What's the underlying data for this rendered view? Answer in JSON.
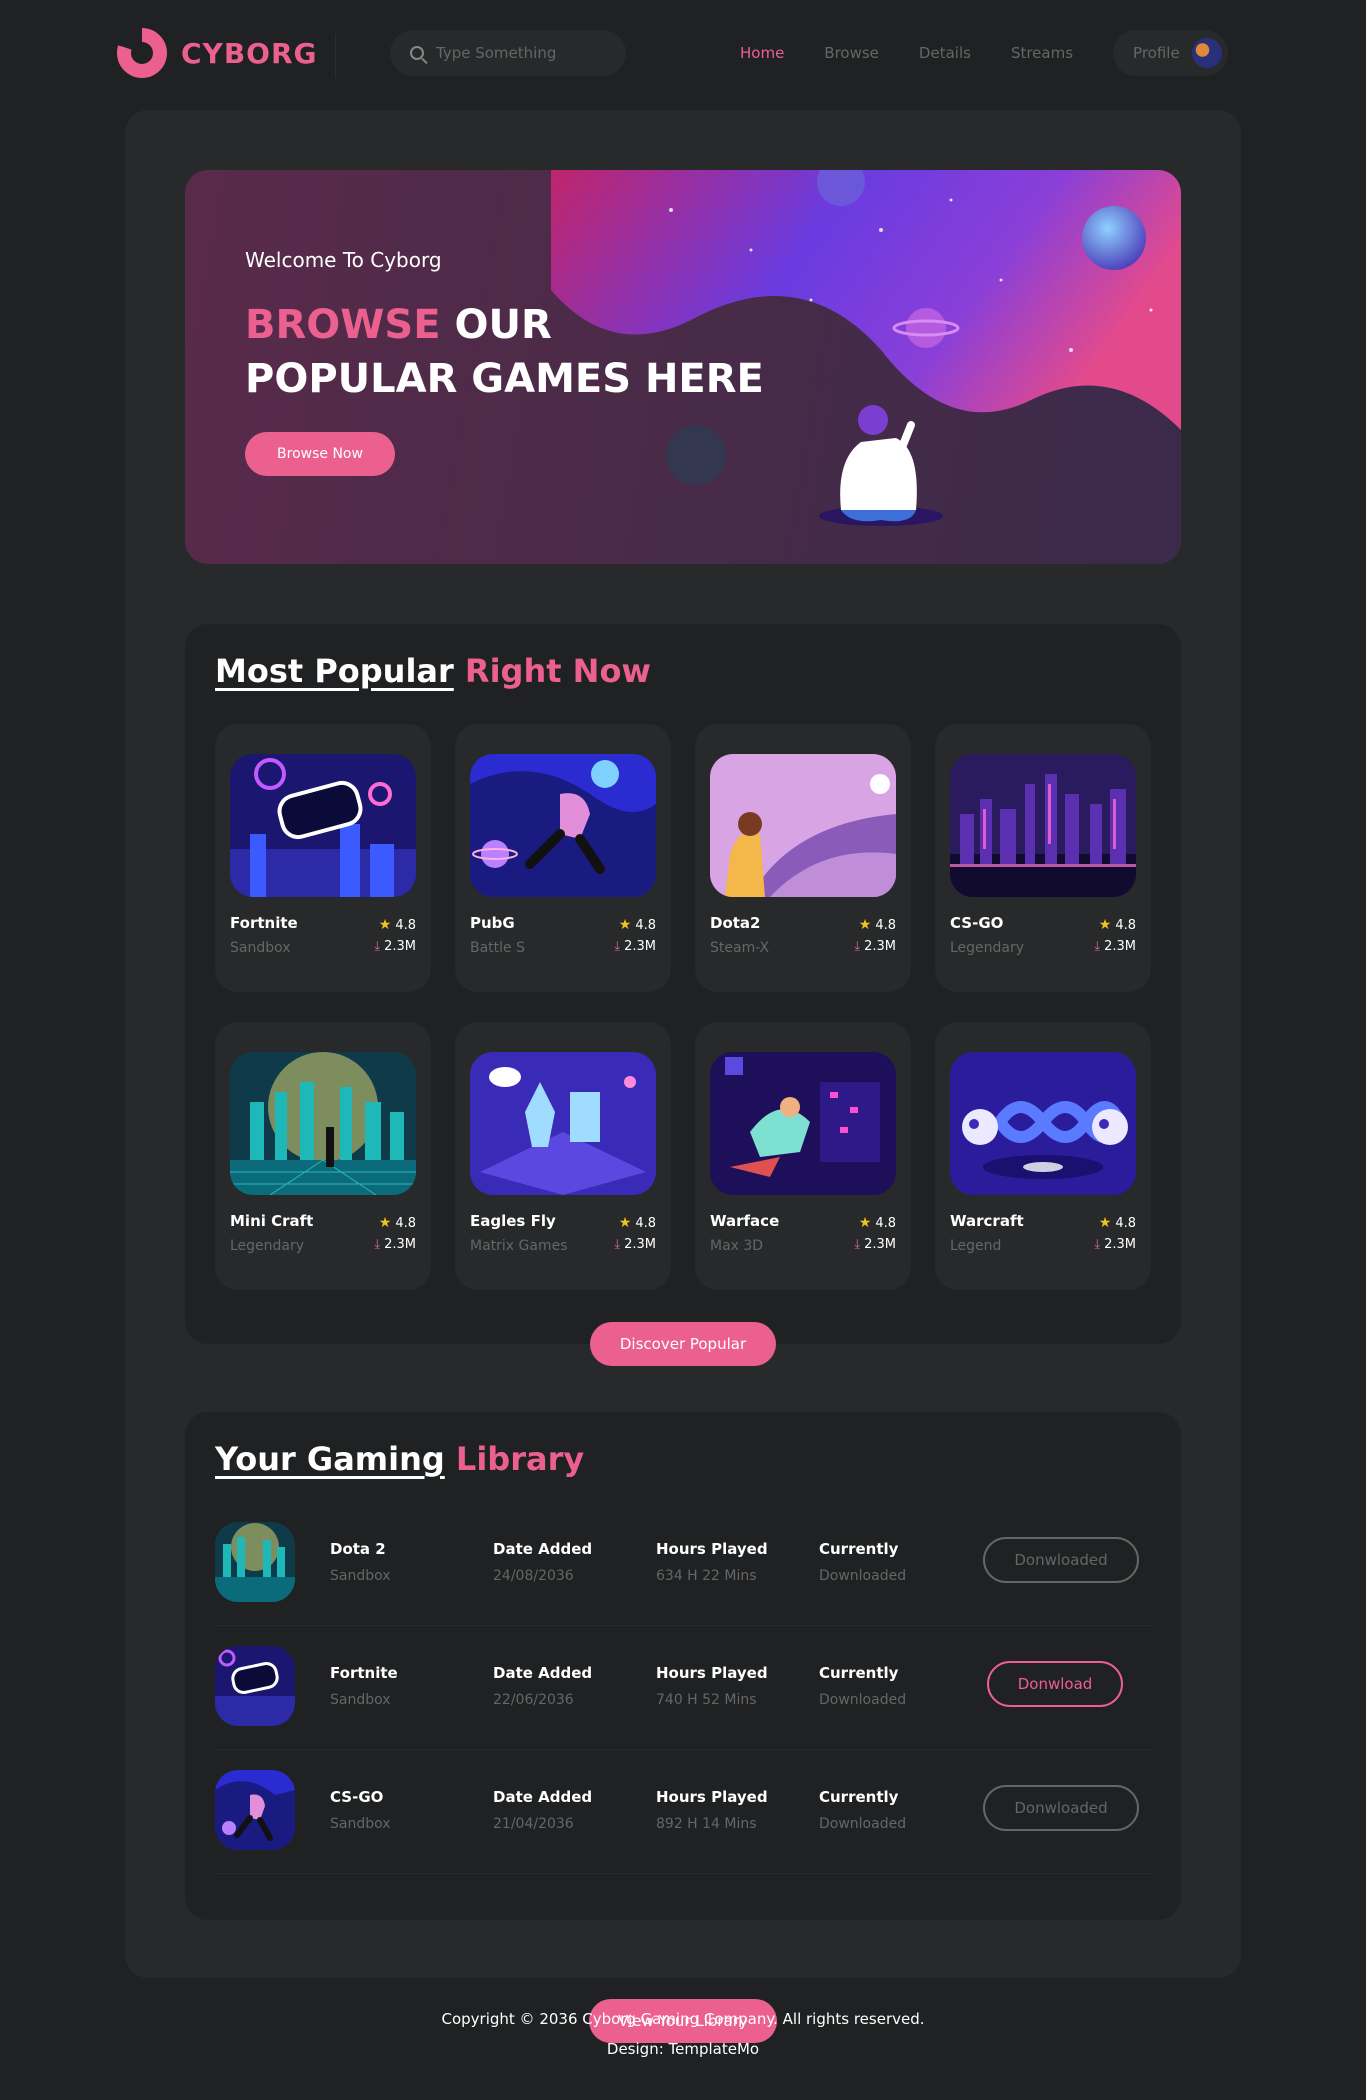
{
  "colors": {
    "accent": "#ec6090",
    "bg": "#1f2122",
    "panel": "#27292a",
    "muted": "#666666",
    "star": "#f0c419"
  },
  "brand": {
    "name": "CYBORG"
  },
  "search": {
    "placeholder": "Type Something"
  },
  "nav": {
    "items": [
      {
        "label": "Home",
        "active": true
      },
      {
        "label": "Browse"
      },
      {
        "label": "Details"
      },
      {
        "label": "Streams"
      }
    ],
    "profile_label": "Profile"
  },
  "banner": {
    "welcome": "Welcome To Cyborg",
    "headline_highlight": "BROWSE",
    "headline_rest1": " OUR",
    "headline_line2": "POPULAR GAMES HERE",
    "button": "Browse Now"
  },
  "popular": {
    "title_underlined": "Most Popular",
    "title_highlight": "Right Now",
    "games": [
      {
        "name": "Fortnite",
        "category": "Sandbox",
        "rating": "4.8",
        "downloads": "2.3M"
      },
      {
        "name": "PubG",
        "category": "Battle S",
        "rating": "4.8",
        "downloads": "2.3M"
      },
      {
        "name": "Dota2",
        "category": "Steam-X",
        "rating": "4.8",
        "downloads": "2.3M"
      },
      {
        "name": "CS-GO",
        "category": "Legendary",
        "rating": "4.8",
        "downloads": "2.3M"
      },
      {
        "name": "Mini Craft",
        "category": "Legendary",
        "rating": "4.8",
        "downloads": "2.3M"
      },
      {
        "name": "Eagles Fly",
        "category": "Matrix Games",
        "rating": "4.8",
        "downloads": "2.3M"
      },
      {
        "name": "Warface",
        "category": "Max 3D",
        "rating": "4.8",
        "downloads": "2.3M"
      },
      {
        "name": "Warcraft",
        "category": "Legend",
        "rating": "4.8",
        "downloads": "2.3M"
      }
    ],
    "button": "Discover Popular"
  },
  "library": {
    "title_underlined": "Your Gaming",
    "title_highlight": "Library",
    "rows": [
      {
        "name": "Dota 2",
        "category": "Sandbox",
        "date_label": "Date Added",
        "date": "24/08/2036",
        "hours_label": "Hours Played",
        "hours": "634 H 22 Mins",
        "status_label": "Currently",
        "status": "Downloaded",
        "button": "Donwloaded",
        "button_active": false
      },
      {
        "name": "Fortnite",
        "category": "Sandbox",
        "date_label": "Date Added",
        "date": "22/06/2036",
        "hours_label": "Hours Played",
        "hours": "740 H 52 Mins",
        "status_label": "Currently",
        "status": "Downloaded",
        "button": "Donwload",
        "button_active": true
      },
      {
        "name": "CS-GO",
        "category": "Sandbox",
        "date_label": "Date Added",
        "date": "21/04/2036",
        "hours_label": "Hours Played",
        "hours": "892 H 14 Mins",
        "status_label": "Currently",
        "status": "Downloaded",
        "button": "Donwloaded",
        "button_active": false
      }
    ],
    "button": "View Your Library"
  },
  "footer": {
    "copyright": "Copyright © 2036 Cyborg Gaming Company. All rights reserved.",
    "design": "Design: TemplateMo"
  }
}
